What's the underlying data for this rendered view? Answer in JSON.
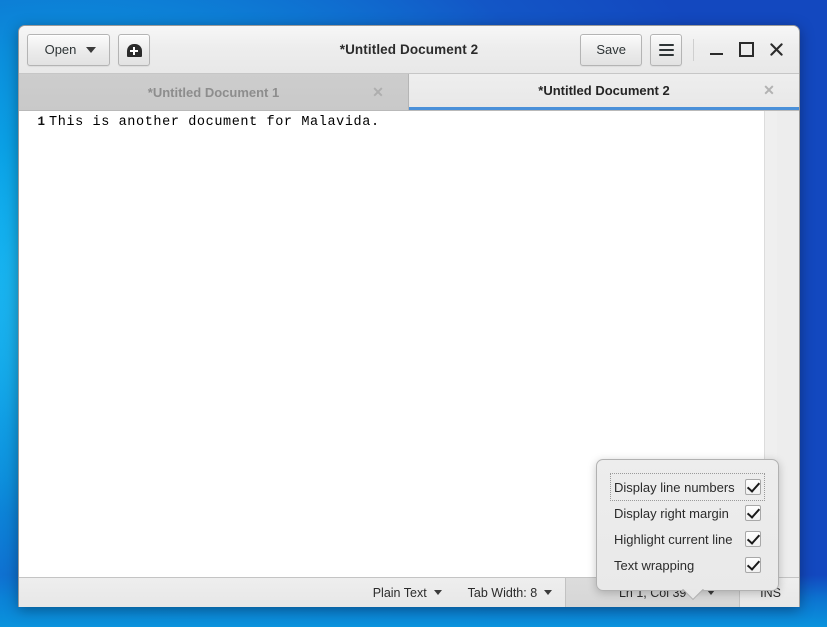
{
  "window": {
    "title": "*Untitled Document 2",
    "headerbar": {
      "open_label": "Open",
      "open_caret_icon": "chevron-down-icon",
      "new_document_icon": "new-document-icon",
      "save_label": "Save",
      "menu_icon": "hamburger-menu-icon",
      "minimize_icon": "minimize-icon",
      "maximize_icon": "maximize-icon",
      "close_icon": "close-icon"
    },
    "tabs": [
      {
        "label": "*Untitled Document 1",
        "active": false,
        "close_icon": "close-icon"
      },
      {
        "label": "*Untitled Document 2",
        "active": true,
        "close_icon": "close-icon"
      }
    ],
    "editor": {
      "line_number": "1",
      "line_text": "This is another document for Malavida."
    },
    "popover": {
      "items": [
        {
          "label": "Display line numbers",
          "checked": true,
          "focused": true
        },
        {
          "label": "Display right margin",
          "checked": true,
          "focused": false
        },
        {
          "label": "Highlight current line",
          "checked": true,
          "focused": false
        },
        {
          "label": "Text wrapping",
          "checked": true,
          "focused": false
        }
      ]
    },
    "statusbar": {
      "language": "Plain Text",
      "tab_width": "Tab Width: 8",
      "position": "Ln 1, Col 39",
      "insert_mode": "INS"
    }
  },
  "colors": {
    "accent": "#4a90d9",
    "desktop_blue_light": "#0aa2e6",
    "desktop_blue_dark": "#1348bf",
    "window_chrome": "#ededed",
    "editor_bg": "#ffffff"
  }
}
